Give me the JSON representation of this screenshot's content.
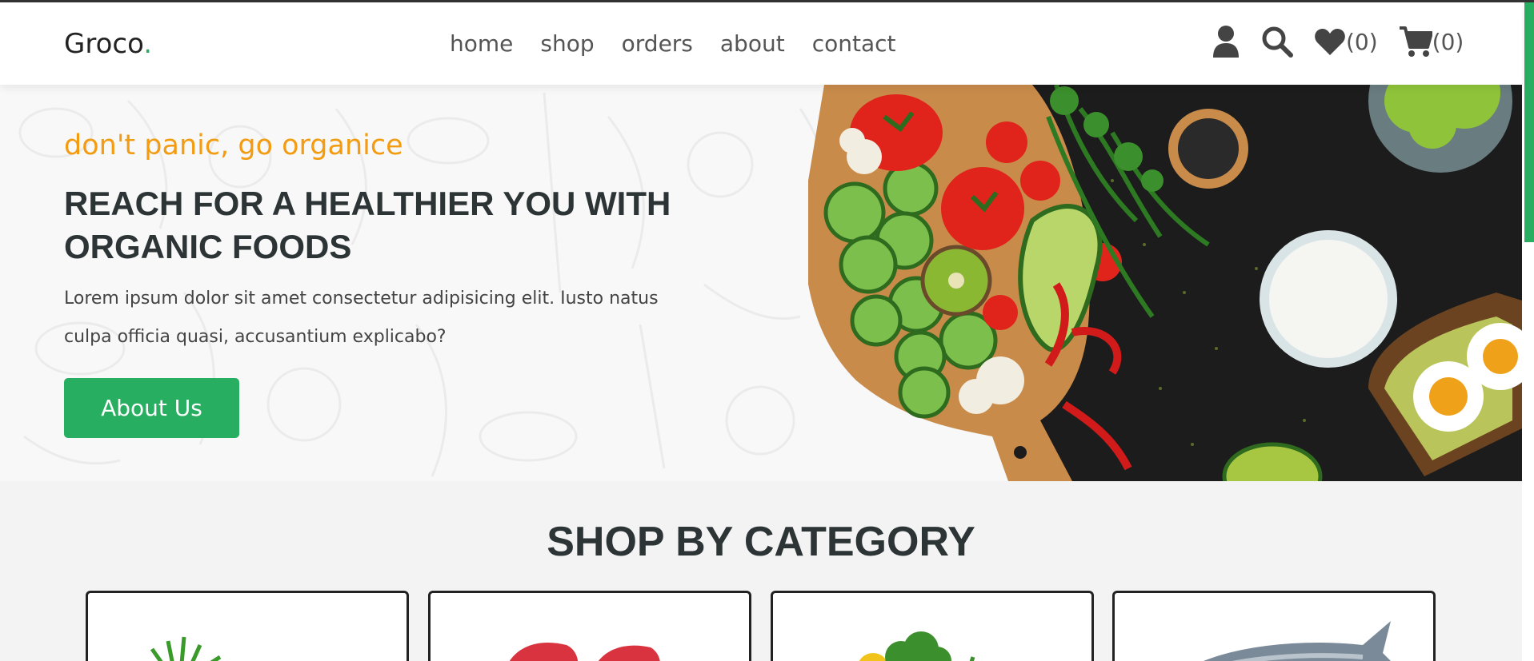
{
  "header": {
    "logo_text": "Groco",
    "logo_dot": ".",
    "nav": [
      "home",
      "shop",
      "orders",
      "about",
      "contact"
    ],
    "wishlist_count": "(0)",
    "cart_count": "(0)"
  },
  "hero": {
    "tagline": "don't panic, go organice",
    "headline": "REACH FOR A HEALTHIER YOU WITH ORGANIC FOODS",
    "description": "Lorem ipsum dolor sit amet consectetur adipisicing elit. Iusto natus culpa officia quasi, accusantium explicabo?",
    "button_label": "About Us"
  },
  "categories": {
    "title": "SHOP BY CATEGORY"
  },
  "colors": {
    "accent": "#27ae60",
    "tagline": "#f39c12",
    "heading": "#2d3436"
  },
  "icons": [
    "user-icon",
    "search-icon",
    "heart-icon",
    "cart-icon"
  ]
}
